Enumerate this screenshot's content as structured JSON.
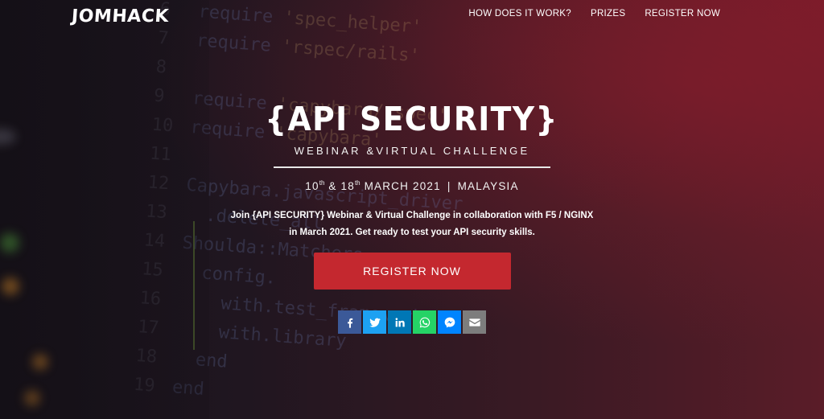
{
  "header": {
    "logo": "JOMHACK",
    "nav": [
      {
        "label": "HOW DOES IT WORK?"
      },
      {
        "label": "PRIZES"
      },
      {
        "label": "REGISTER NOW"
      }
    ]
  },
  "hero": {
    "title": "{API SECURITY}",
    "subtitle": "WEBINAR &VIRTUAL CHALLENGE",
    "date1_day": "10",
    "date1_suffix": "th",
    "date_amp": "&",
    "date2_day": "18",
    "date2_suffix": "th",
    "date_month_year": "MARCH 2021",
    "date_separator": "|",
    "location": "MALAYSIA",
    "description_line1": "Join {API SECURITY} Webinar & Virtual Challenge in collaboration with F5 / NGINX",
    "description_line2": "in March 2021. Get ready to test your API security skills.",
    "cta_label": "REGISTER NOW"
  },
  "share": [
    {
      "name": "facebook-icon",
      "color": "#3b5998"
    },
    {
      "name": "twitter-icon",
      "color": "#1da1f2"
    },
    {
      "name": "linkedin-icon",
      "color": "#0077b5"
    },
    {
      "name": "whatsapp-icon",
      "color": "#25d366"
    },
    {
      "name": "messenger-icon",
      "color": "#0084ff"
    },
    {
      "name": "email-icon",
      "color": "#7d7d7d"
    }
  ],
  "colors": {
    "accent": "#c4282f"
  }
}
